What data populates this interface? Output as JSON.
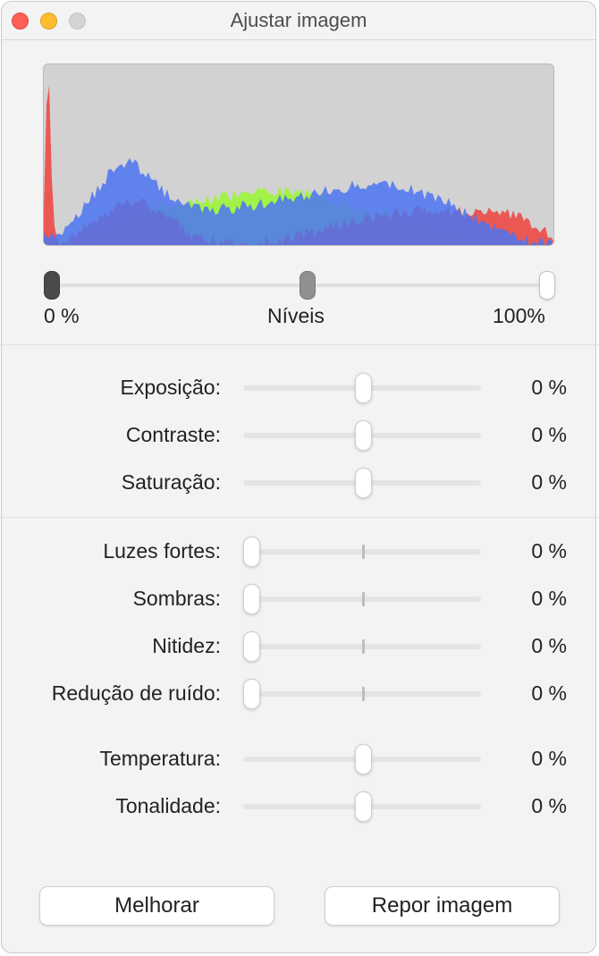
{
  "window": {
    "title": "Ajustar imagem",
    "controls": [
      "close-button",
      "minimize-button",
      "zoom-button"
    ]
  },
  "levels": {
    "label": "Níveis",
    "min_label": "0 %",
    "max_label": "100%",
    "handles": {
      "black": 0,
      "mid": 0.5,
      "white": 1
    }
  },
  "histogram": {
    "channels": [
      "red",
      "green",
      "blue"
    ],
    "colors": {
      "red": "#f0433d",
      "green": "#9cf53a",
      "blue": "#4c74f2",
      "background": "#d2d2d2"
    }
  },
  "adjustments": [
    {
      "label": "Exposição:",
      "value": "0 %",
      "position": 0.5
    },
    {
      "label": "Contraste:",
      "value": "0 %",
      "position": 0.5
    },
    {
      "label": "Saturação:",
      "value": "0 %",
      "position": 0.5
    },
    {
      "label": "Luzes fortes:",
      "value": "0 %",
      "position": 0
    },
    {
      "label": "Sombras:",
      "value": "0 %",
      "position": 0
    },
    {
      "label": "Nitidez:",
      "value": "0 %",
      "position": 0
    },
    {
      "label": "Redução de ruído:",
      "value": "0 %",
      "position": 0
    },
    {
      "label": "Temperatura:",
      "value": "0 %",
      "position": 0.5
    },
    {
      "label": "Tonalidade:",
      "value": "0 %",
      "position": 0.5
    }
  ],
  "buttons": {
    "enhance": "Melhorar",
    "reset": "Repor imagem"
  }
}
